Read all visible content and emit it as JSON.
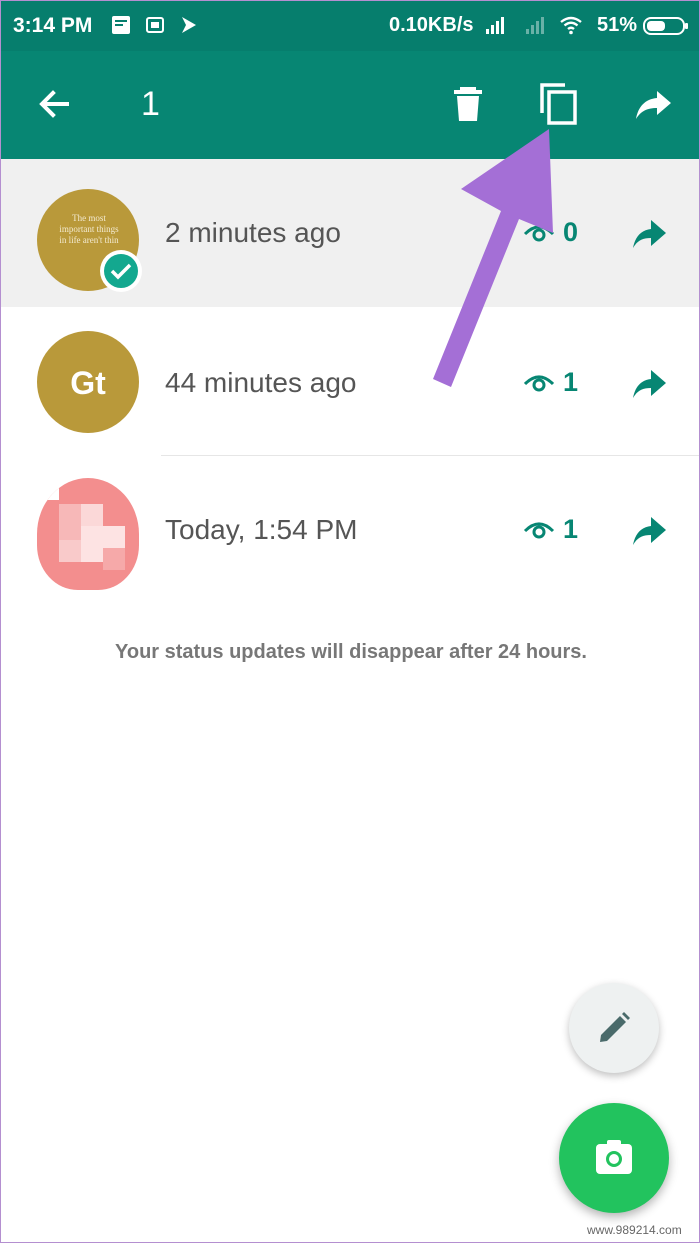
{
  "statusbar": {
    "time": "3:14 PM",
    "network_speed": "0.10KB/s",
    "battery": "51%"
  },
  "actionbar": {
    "selected_count": "1",
    "icons": [
      "back-arrow-icon",
      "delete-icon",
      "copy-icon",
      "forward-icon"
    ]
  },
  "statuses": [
    {
      "time": "2 minutes ago",
      "views": "0",
      "selected": true,
      "thumbnail_text": "The most important things in life aren't thin"
    },
    {
      "time": "44 minutes ago",
      "views": "1",
      "selected": false,
      "initials": "Gt"
    },
    {
      "time": "Today, 1:54 PM",
      "views": "1",
      "selected": false
    }
  ],
  "note": "Your status updates will disappear after 24 hours.",
  "watermark": "www.989214.com",
  "colors": {
    "header": "#078673",
    "statusbar": "#067e6d",
    "accent": "#078673",
    "fab": "#22c35e",
    "annotation_arrow": "#a46fd6"
  }
}
